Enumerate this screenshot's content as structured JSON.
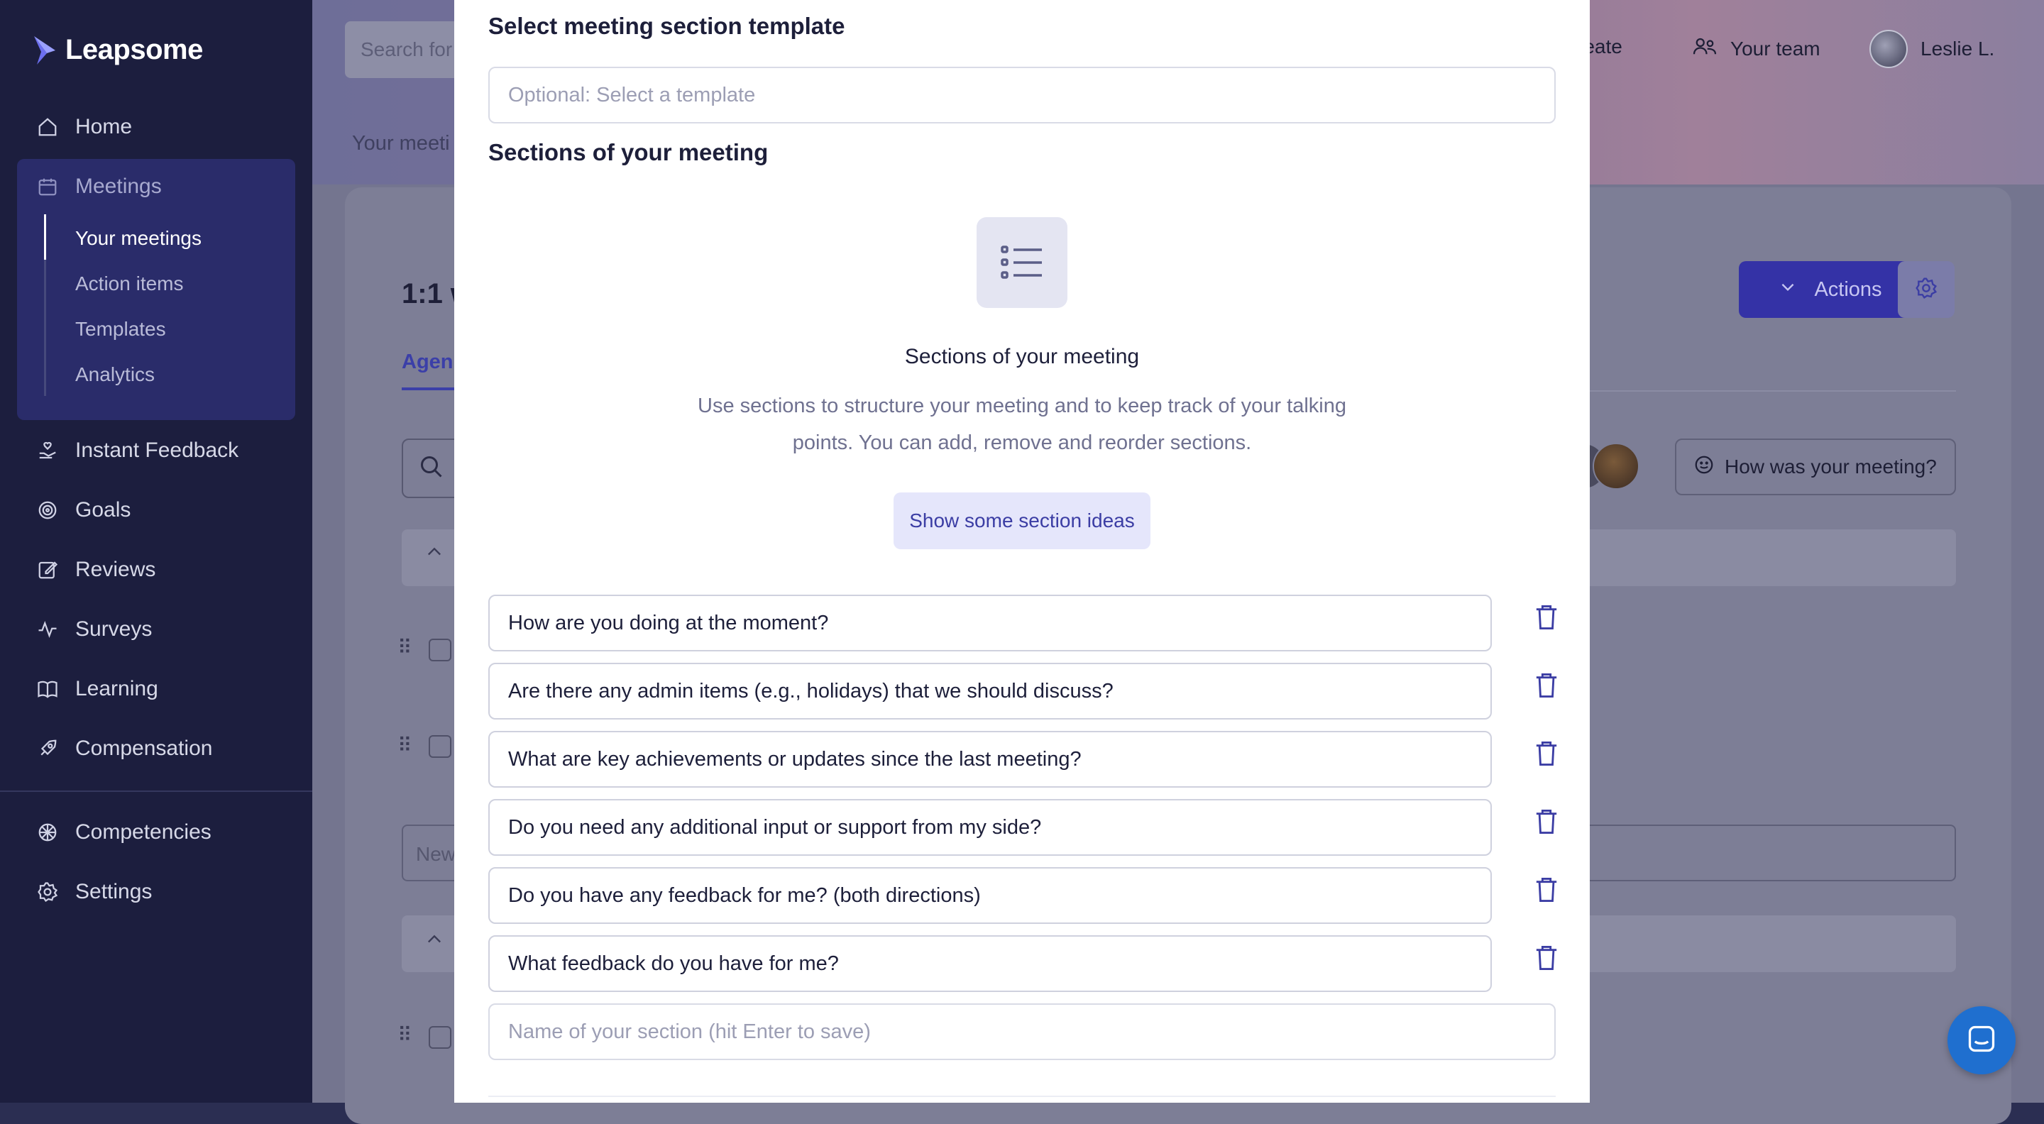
{
  "app": {
    "brand": "Leapsome",
    "accent": "#3b3da4",
    "sidebar_bg": "#1c1e3e"
  },
  "sidebar": {
    "items": [
      {
        "label": "Home",
        "icon": "home-icon"
      },
      {
        "label": "Meetings",
        "icon": "calendar-icon"
      },
      {
        "label": "Instant Feedback",
        "icon": "hand-heart-icon"
      },
      {
        "label": "Goals",
        "icon": "target-icon"
      },
      {
        "label": "Reviews",
        "icon": "edit-icon"
      },
      {
        "label": "Surveys",
        "icon": "activity-icon"
      },
      {
        "label": "Learning",
        "icon": "book-icon"
      },
      {
        "label": "Compensation",
        "icon": "rocket-icon"
      },
      {
        "label": "Competencies",
        "icon": "network-icon"
      },
      {
        "label": "Settings",
        "icon": "gear-icon"
      }
    ],
    "meetings_sub": [
      {
        "label": "Your meetings",
        "active": true
      },
      {
        "label": "Action items"
      },
      {
        "label": "Templates"
      },
      {
        "label": "Analytics"
      }
    ]
  },
  "background": {
    "search_placeholder": "Search for",
    "breadcrumb": "Your meeti",
    "page_title": "1:1 w",
    "tab": "Agen",
    "create_label": "reate",
    "team_label": "Your team",
    "user_name": "Leslie L.",
    "actions_label": "Actions",
    "how_was_meeting": "How was your meeting?",
    "new_item_placeholder": "New"
  },
  "modal": {
    "template_label": "Select meeting section template",
    "template_placeholder": "Optional: Select a template",
    "sections_label": "Sections of your meeting",
    "empty_title": "Sections of your meeting",
    "empty_description": "Use sections to structure your meeting and to keep track of your talking points. You can add, remove and reorder sections.",
    "ideas_button": "Show some section ideas",
    "sections": [
      "How are you doing at the moment?",
      "Are there any admin items (e.g., holidays) that we should discuss?",
      "What are key achievements or updates since the last meeting?",
      "Do you need any additional input or support from my side?",
      "Do you have any feedback for me? (both directions)",
      "What feedback do you have for me?"
    ],
    "new_section_placeholder": "Name of your section (hit Enter to save)"
  }
}
